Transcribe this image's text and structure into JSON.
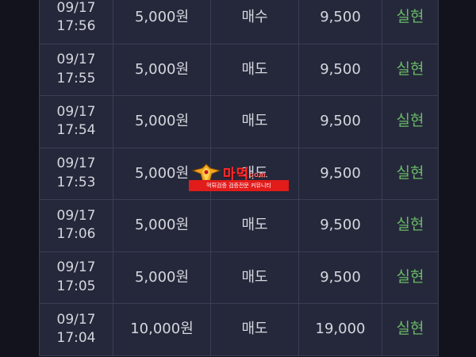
{
  "colors": {
    "background": "#12131c",
    "table_bg": "#25283a",
    "border": "#3a3f55",
    "text": "#d5d7de",
    "status": "#69b968",
    "watermark_red": "#e21b1b"
  },
  "rows": [
    {
      "date": "09/17",
      "time": "17:56",
      "amount": "5,000원",
      "type": "매수",
      "price": "9,500",
      "status": "실현"
    },
    {
      "date": "09/17",
      "time": "17:55",
      "amount": "5,000원",
      "type": "매도",
      "price": "9,500",
      "status": "실현"
    },
    {
      "date": "09/17",
      "time": "17:54",
      "amount": "5,000원",
      "type": "매도",
      "price": "9,500",
      "status": "실현"
    },
    {
      "date": "09/17",
      "time": "17:53",
      "amount": "5,000원",
      "type": "매도",
      "price": "9,500",
      "status": "실현"
    },
    {
      "date": "09/17",
      "time": "17:06",
      "amount": "5,000원",
      "type": "매도",
      "price": "9,500",
      "status": "실현"
    },
    {
      "date": "09/17",
      "time": "17:05",
      "amount": "5,000원",
      "type": "매도",
      "price": "9,500",
      "status": "실현"
    },
    {
      "date": "09/17",
      "time": "17:04",
      "amount": "10,000원",
      "type": "매도",
      "price": "19,000",
      "status": "실현"
    }
  ],
  "watermark": {
    "brand": "마먹",
    "brand_small": "com",
    "tagline": "먹튀검증 검증전문 커뮤니티",
    "icon": "eagle-emblem-icon"
  }
}
